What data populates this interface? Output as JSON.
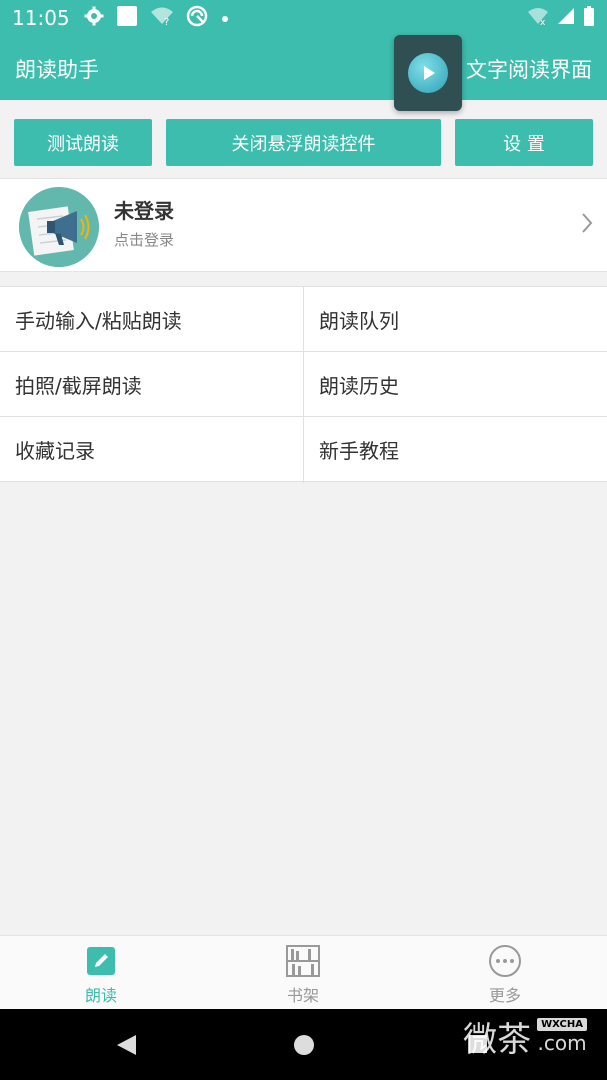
{
  "status_bar": {
    "time": "11:05",
    "icons": [
      "settings-gear-icon",
      "square-notification-icon",
      "wifi-question-icon",
      "vpn-icon",
      "dot-icon",
      "wifi-x-icon",
      "signal-icon",
      "battery-icon"
    ]
  },
  "app_bar": {
    "title": "朗读助手",
    "right_title": "文字阅读界面"
  },
  "buttons": {
    "test_read": "测试朗读",
    "close_float": "关闭悬浮朗读控件",
    "settings": "设 置"
  },
  "profile": {
    "name": "未登录",
    "subtitle": "点击登录"
  },
  "menu": [
    {
      "label": "手动输入/粘贴朗读"
    },
    {
      "label": "朗读队列"
    },
    {
      "label": "拍照/截屏朗读"
    },
    {
      "label": "朗读历史"
    },
    {
      "label": "收藏记录"
    },
    {
      "label": "新手教程"
    }
  ],
  "tabs": [
    {
      "label": "朗读",
      "active": true
    },
    {
      "label": "书架",
      "active": false
    },
    {
      "label": "更多",
      "active": false
    }
  ],
  "watermark": {
    "text": "微茶",
    "tag": "WXCHA",
    "domain": ".com"
  },
  "colors": {
    "primary": "#3dbdad",
    "background": "#f2f2f2",
    "text": "#333333",
    "muted": "#888888",
    "inactive_tab": "#999999"
  }
}
